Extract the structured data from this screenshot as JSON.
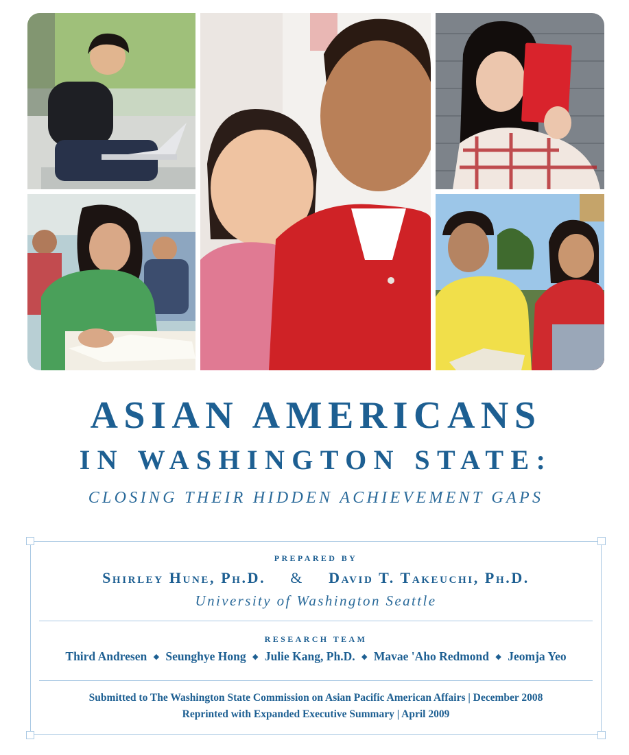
{
  "title": {
    "line1": "ASIAN AMERICANS",
    "line2": "IN WASHINGTON STATE:",
    "line3": "CLOSING THEIR HIDDEN ACHIEVEMENT GAPS"
  },
  "credits": {
    "prepared_by_label": "PREPARED BY",
    "author1": "Shirley Hune, Ph.D.",
    "ampersand": "&",
    "author2": "David T. Takeuchi, Ph.D.",
    "university": "University of Washington Seattle",
    "research_team_label": "RESEARCH TEAM",
    "team_members": [
      "Third Andresen",
      "Seunghye Hong",
      "Julie Kang, Ph.D.",
      "Mavae 'Aho Redmond",
      "Jeomja Yeo"
    ],
    "separator": "◆",
    "submitted": "Submitted to The Washington State Commission on Asian Pacific American Affairs | December 2008",
    "reprinted": "Reprinted with Expanded Executive Summary | April 2009"
  },
  "colors": {
    "primary_blue": "#1d5f92",
    "frame_blue": "#a9c8e3"
  }
}
